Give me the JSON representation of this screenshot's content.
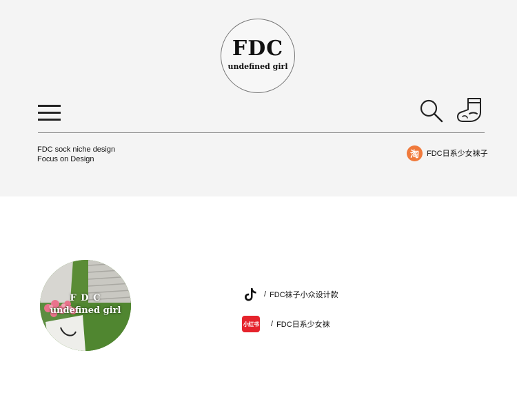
{
  "brand": {
    "name": "FDC",
    "subtitle": "undefined girl"
  },
  "header": {
    "tagline_line1": "FDC sock niche design",
    "tagline_line2": "Focus on Design",
    "shop": {
      "icon_glyph": "淘",
      "label": "FDC日系少女袜子"
    },
    "icons": [
      "menu-icon",
      "search-icon",
      "sock-icon"
    ]
  },
  "profile": {
    "photo_title": "F D C",
    "photo_subtitle": "undefined girl"
  },
  "social": [
    {
      "icon": "tiktok-icon",
      "separator": "/",
      "label": "FDC袜子小众设计款"
    },
    {
      "icon": "xiaohongshu-icon",
      "icon_text": "小红书",
      "separator": "/",
      "label": "FDC日系少女袜"
    }
  ],
  "colors": {
    "header_bg": "#f4f4f4",
    "taobao_orange": "#f07a3c",
    "xiaohongshu_red": "#e5232c"
  }
}
